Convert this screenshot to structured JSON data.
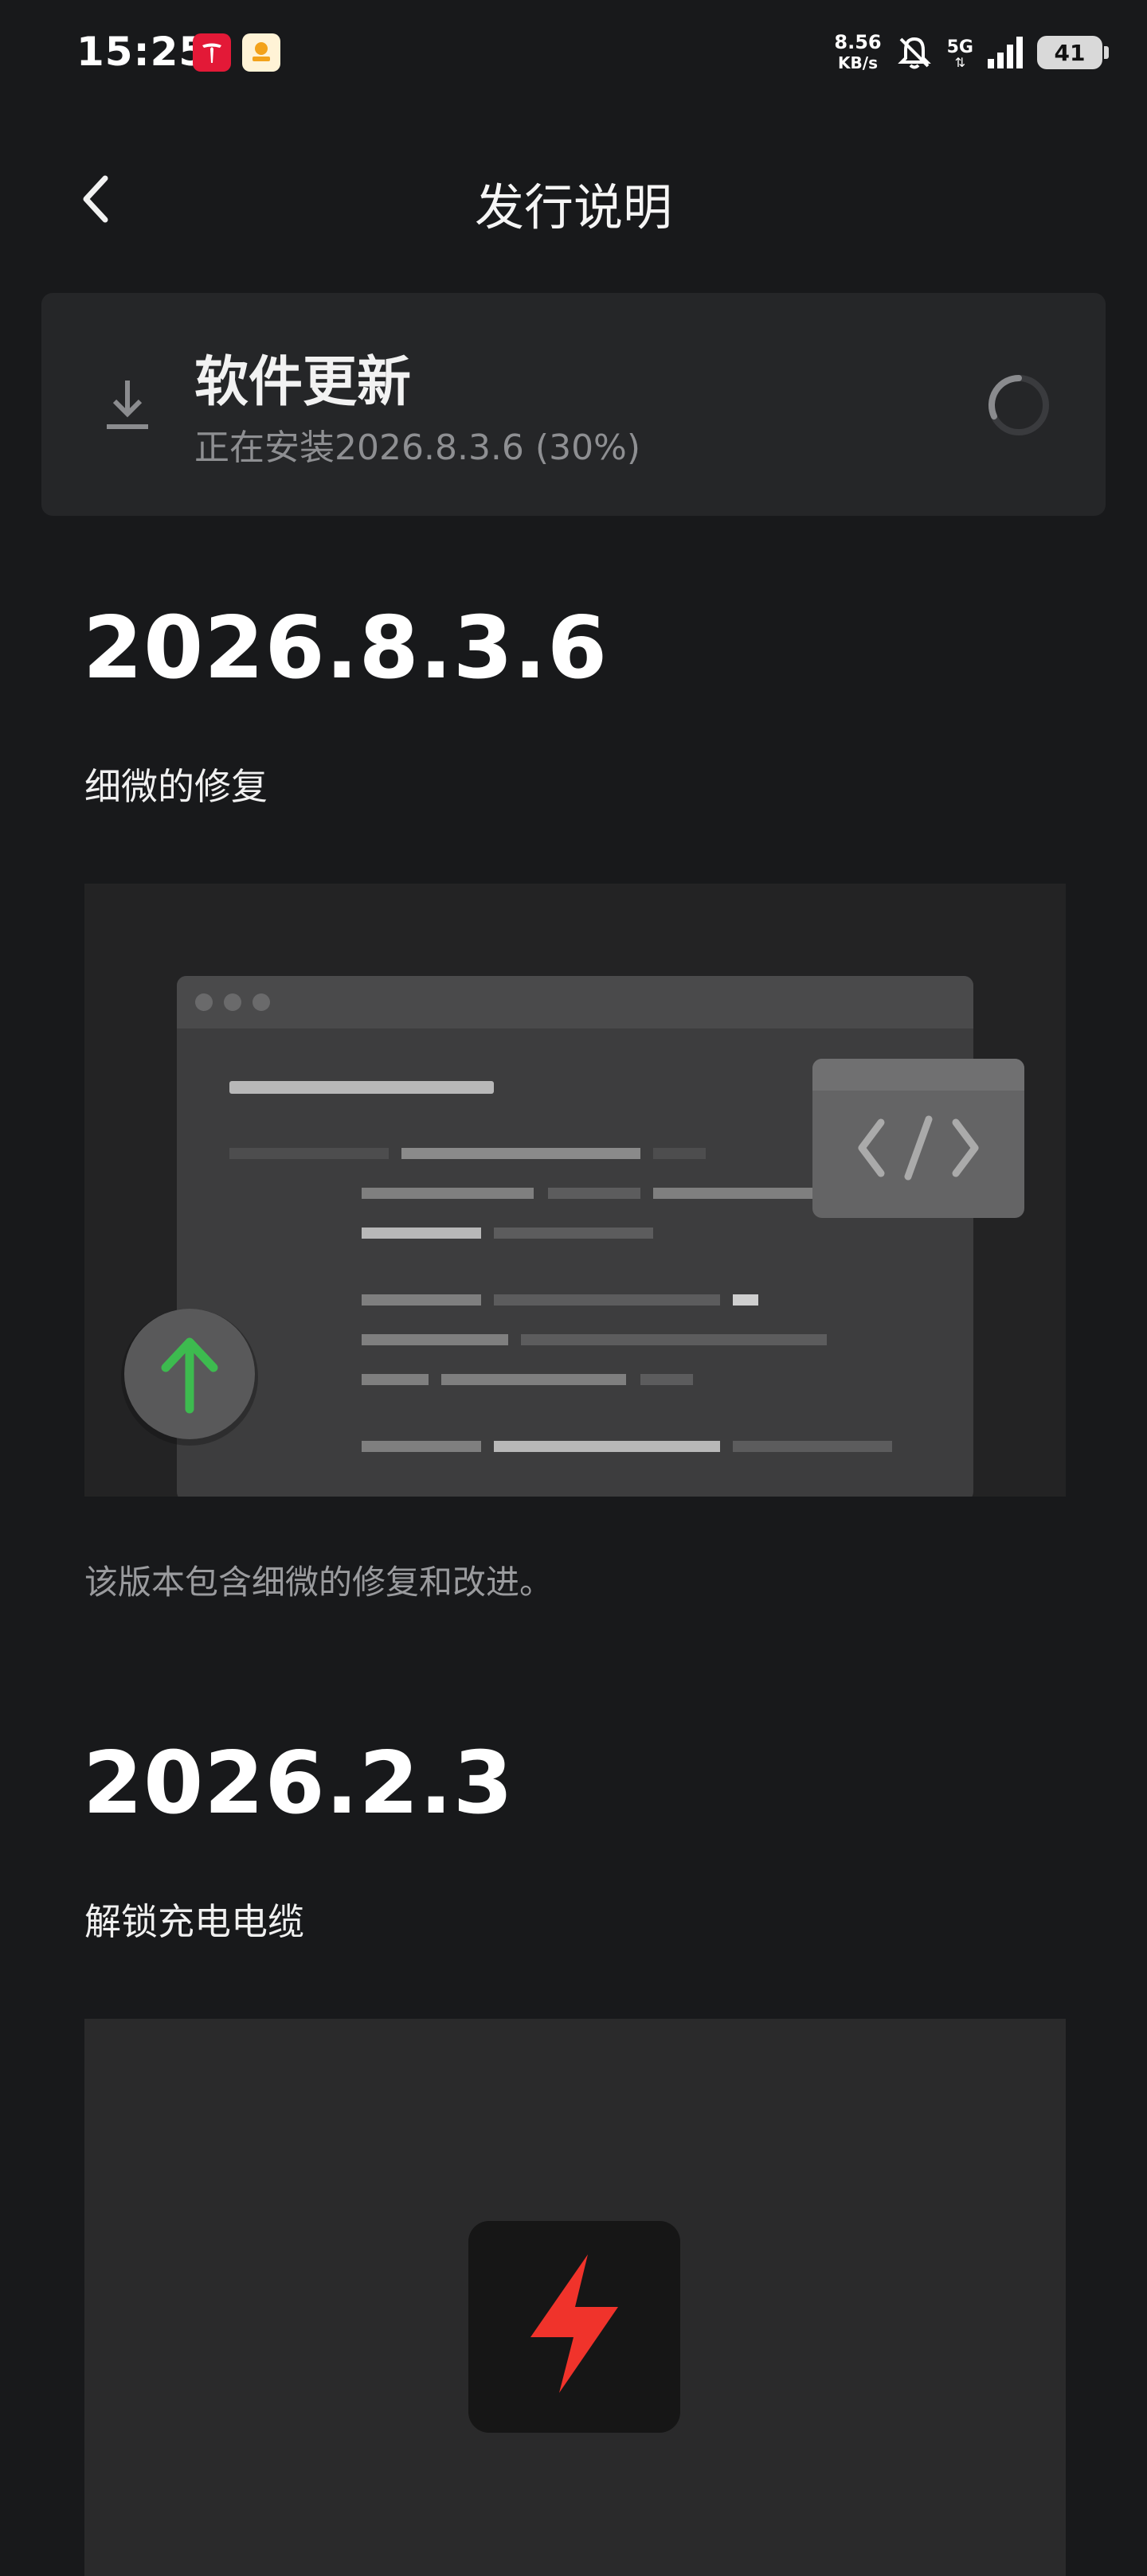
{
  "status_bar": {
    "time": "15:25",
    "net_speed_value": "8.56",
    "net_speed_unit": "KB/s",
    "network": "5G",
    "battery": "41"
  },
  "header": {
    "title": "发行说明"
  },
  "update_card": {
    "title": "软件更新",
    "status": "正在安装2026.8.3.6 (30%)",
    "progress_percent": 30
  },
  "releases": [
    {
      "version": "2026.8.3.6",
      "subtitle": "细微的修复",
      "description": "该版本包含细微的修复和改进。"
    },
    {
      "version": "2026.2.3",
      "subtitle": "解锁充电电缆"
    }
  ],
  "colors": {
    "background": "#18191b",
    "card": "#252628",
    "accent_green": "#3dbb4f",
    "accent_red": "#f0332b",
    "tesla_red": "#e31937"
  },
  "icons": [
    "back-chevron-icon",
    "download-icon",
    "loading-spinner-icon",
    "code-icon",
    "arrow-up-icon",
    "lightning-bolt-icon",
    "mute-bell-icon",
    "signal-icon"
  ]
}
